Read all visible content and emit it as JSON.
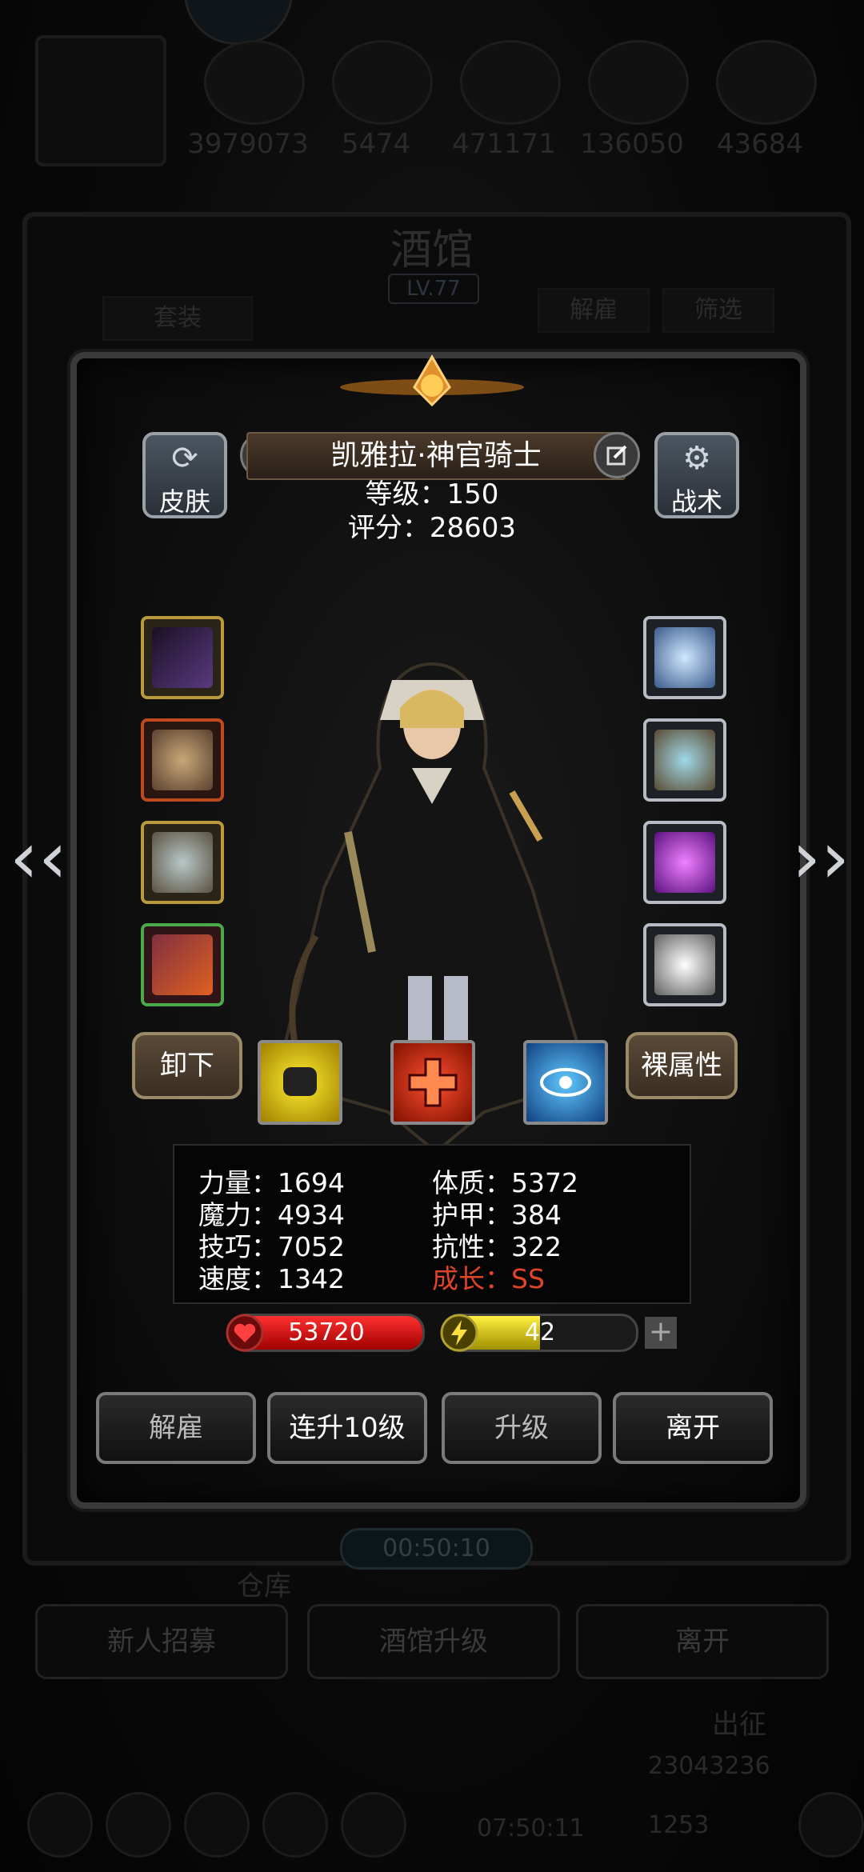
{
  "resources": {
    "values": [
      "3979073",
      "5474",
      "471171",
      "136050",
      "43684"
    ]
  },
  "tavern": {
    "title": "酒馆",
    "level": "LV.77",
    "set_btn": "套装",
    "dismiss_btn": "解雇",
    "filter_btn": "筛选"
  },
  "hero": {
    "name": "凯雅拉·神官骑士",
    "level_label": "等级：150",
    "score_label": "评分：28603",
    "skin_btn": "皮肤",
    "tactics_btn": "战术",
    "unequip_btn": "卸下",
    "naked_attr_btn": "裸属性"
  },
  "stats": {
    "strength": "力量：1694",
    "magic": "魔力：4934",
    "skill": "技巧：7052",
    "speed": "速度：1342",
    "constitution": "体质：5372",
    "armor": "护甲：384",
    "resistance": "抗性：322",
    "growth": "成长：SS"
  },
  "bars": {
    "hp": "53720",
    "energy": "42",
    "energy_fraction": 0.5
  },
  "actions": {
    "dismiss": "解雇",
    "level10": "连升10级",
    "levelup": "升级",
    "leave": "离开"
  },
  "bottom": {
    "timer": "00:50:10",
    "warehouse": "仓库",
    "recruit": "新人招募",
    "upgrade": "酒馆升级",
    "leave": "离开",
    "expedition": "出征",
    "gold": "23043236",
    "gems": "1253",
    "timer2": "07:50:11"
  },
  "colors": {
    "growth": "#e0442a",
    "hp": "#d01818",
    "energy": "#e8d81a"
  }
}
